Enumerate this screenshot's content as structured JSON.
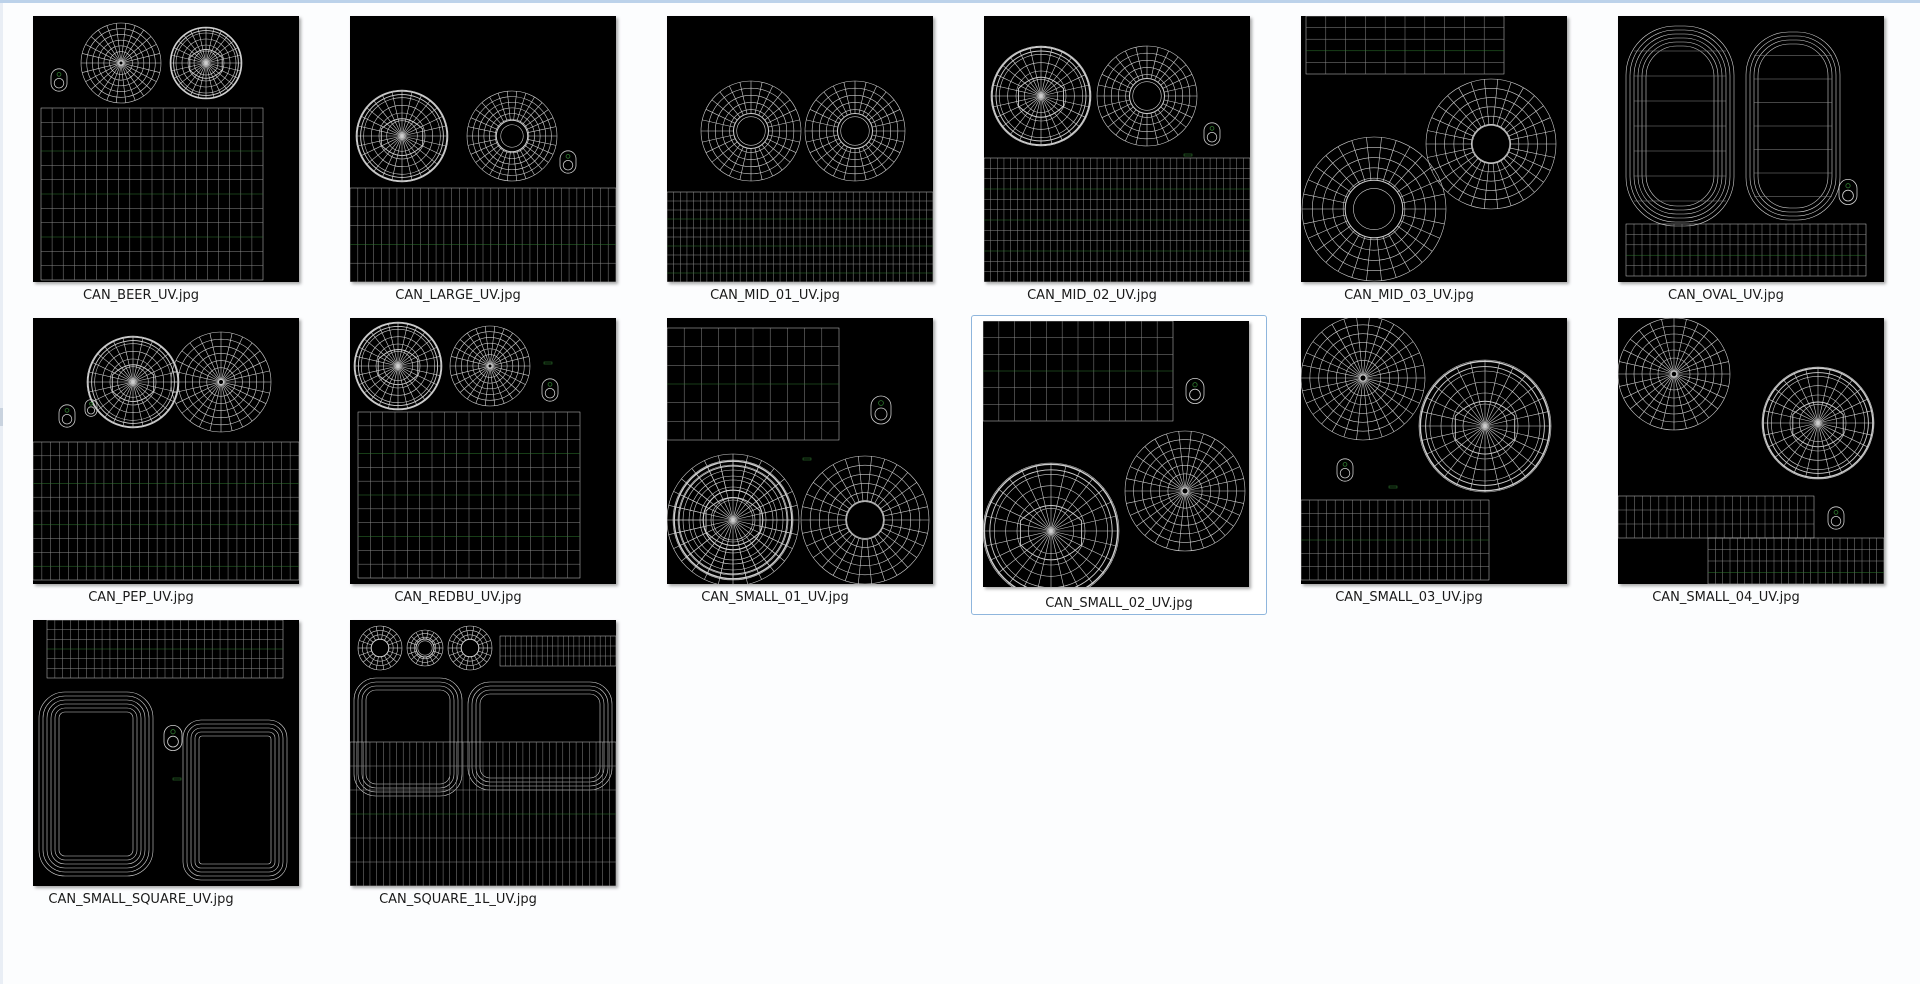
{
  "folder": {
    "files": [
      {
        "name": "CAN_BEER_UV.jpg",
        "selected": false
      },
      {
        "name": "CAN_LARGE_UV.jpg",
        "selected": false
      },
      {
        "name": "CAN_MID_01_UV.jpg",
        "selected": false
      },
      {
        "name": "CAN_MID_02_UV.jpg",
        "selected": false
      },
      {
        "name": "CAN_MID_03_UV.jpg",
        "selected": false
      },
      {
        "name": "CAN_OVAL_UV.jpg",
        "selected": false
      },
      {
        "name": "CAN_PEP_UV.jpg",
        "selected": false
      },
      {
        "name": "CAN_REDBU_UV.jpg",
        "selected": false
      },
      {
        "name": "CAN_SMALL_01_UV.jpg",
        "selected": false
      },
      {
        "name": "CAN_SMALL_02_UV.jpg",
        "selected": true
      },
      {
        "name": "CAN_SMALL_03_UV.jpg",
        "selected": false
      },
      {
        "name": "CAN_SMALL_04_UV.jpg",
        "selected": false
      },
      {
        "name": "CAN_SMALL_SQUARE_UV.jpg",
        "selected": false
      },
      {
        "name": "CAN_SQUARE_1L_UV.jpg",
        "selected": false
      }
    ]
  },
  "colors": {
    "thumb_background": "#000000",
    "wire_white": "#cfcfcf",
    "wire_green": "#2f7a2f",
    "selection_border": "#8fb6dd"
  }
}
